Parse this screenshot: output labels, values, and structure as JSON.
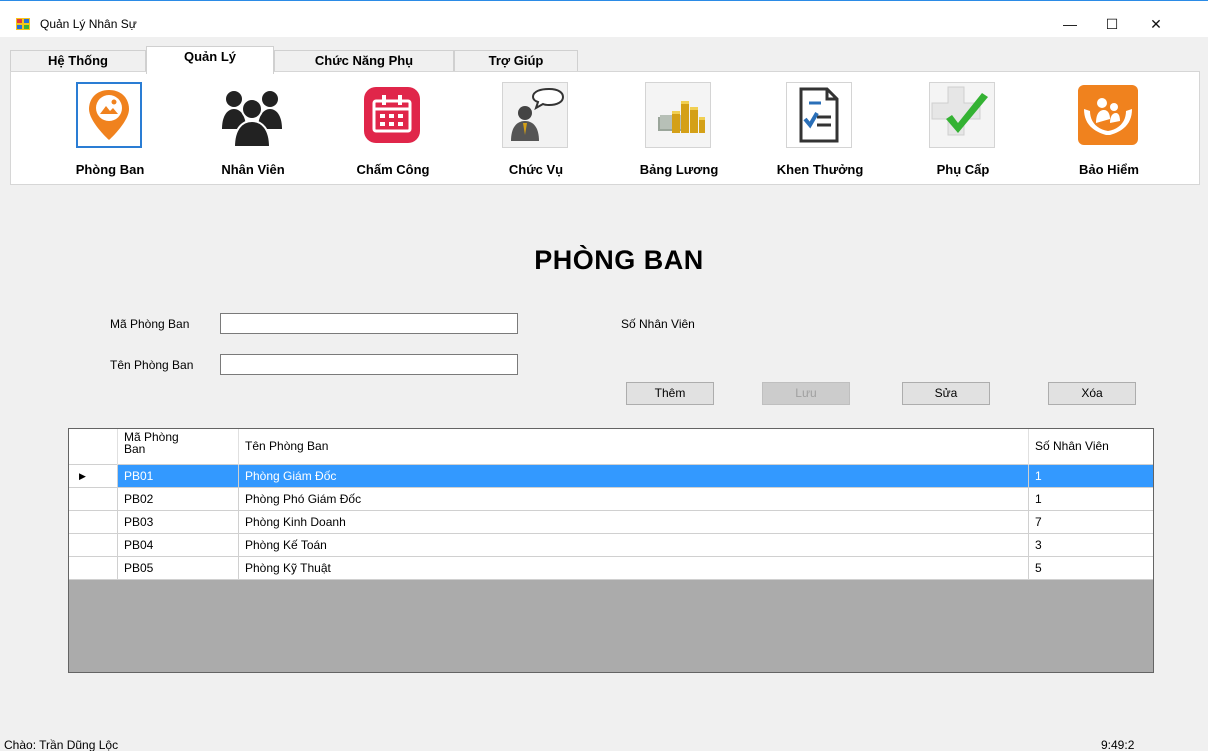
{
  "window": {
    "title": "Quản Lý Nhân Sự",
    "minimize": "—",
    "maximize": "☐",
    "close": "✕"
  },
  "tabs": [
    {
      "label": "Hệ Thống",
      "active": false
    },
    {
      "label": "Quản Lý",
      "active": true
    },
    {
      "label": "Chức Năng Phụ",
      "active": false
    },
    {
      "label": "Trợ Giúp",
      "active": false
    }
  ],
  "toolbar": {
    "items": [
      {
        "label": "Phòng Ban",
        "icon": "location-pin-icon",
        "color": "#f0821e",
        "selected": true
      },
      {
        "label": "Nhân Viên",
        "icon": "people-group-icon",
        "color": "#222222"
      },
      {
        "label": "Chấm Công",
        "icon": "calendar-icon",
        "color": "#e0264a"
      },
      {
        "label": "Chức Vụ",
        "icon": "speech-person-icon",
        "color": "#555555"
      },
      {
        "label": "Bảng Lương",
        "icon": "money-stack-icon",
        "color": "#d4a017"
      },
      {
        "label": "Khen Thưởng",
        "icon": "checklist-icon",
        "color": "#2a6fb8"
      },
      {
        "label": "Phụ Cấp",
        "icon": "green-check-icon",
        "color": "#34b233"
      },
      {
        "label": "Bảo Hiểm",
        "icon": "family-hands-icon",
        "color": "#f0821e"
      }
    ]
  },
  "page": {
    "heading": "PHÒNG BAN"
  },
  "form": {
    "ma_label": "Mã Phòng Ban",
    "ma_value": "",
    "ten_label": "Tên Phòng Ban",
    "ten_value": "",
    "so_nv_label": "Số Nhân Viên"
  },
  "buttons": {
    "them": "Thêm",
    "luu": "Lưu",
    "sua": "Sửa",
    "xoa": "Xóa"
  },
  "grid": {
    "columns": [
      "Mã Phòng Ban",
      "Tên Phòng Ban",
      "Số Nhân Viên"
    ],
    "current_row_marker": "▶",
    "rows": [
      {
        "ma": "PB01",
        "ten": "Phòng Giám Đốc",
        "so": "1",
        "selected": true
      },
      {
        "ma": "PB02",
        "ten": "Phòng Phó Giám Đốc",
        "so": "1"
      },
      {
        "ma": "PB03",
        "ten": "Phòng Kinh Doanh",
        "so": "7"
      },
      {
        "ma": "PB04",
        "ten": "Phòng Kế Toán",
        "so": "3"
      },
      {
        "ma": "PB05",
        "ten": "Phòng Kỹ Thuật",
        "so": "5"
      }
    ]
  },
  "status": {
    "greeting": "Chào: Trần Dũng Lộc",
    "clock": "9:49:2"
  }
}
